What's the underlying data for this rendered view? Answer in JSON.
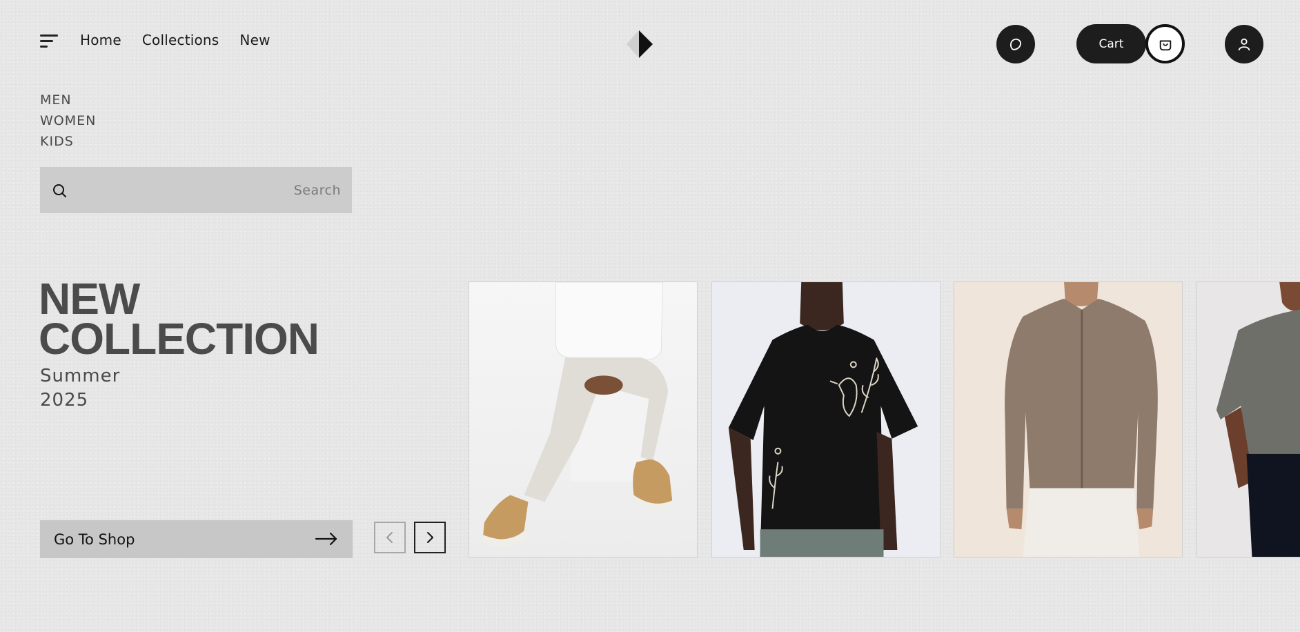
{
  "nav": {
    "links": [
      {
        "label": "Home"
      },
      {
        "label": "Collections"
      },
      {
        "label": "New"
      }
    ],
    "cart_label": "Cart",
    "icons": [
      "menu-icon",
      "brand-logo",
      "heart-icon",
      "bag-icon",
      "user-icon"
    ]
  },
  "categories": [
    {
      "label": "MEN"
    },
    {
      "label": "WOMEN"
    },
    {
      "label": "KIDS"
    }
  ],
  "search": {
    "placeholder": "Search",
    "value": ""
  },
  "hero": {
    "title_line1": "NEW",
    "title_line2": "COLLECTION",
    "subtitle_line1": "Summer",
    "subtitle_line2": "2025",
    "cta_label": "Go To Shop"
  },
  "carousel": {
    "products": [
      {
        "image": "man in white sweatshirt and cream trousers with tan high-top sneakers"
      },
      {
        "image": "man in black t-shirt with embroidered bird and floral motif"
      },
      {
        "image": "man in brown ribbed zip-up knit cardigan"
      },
      {
        "image": "man in washed grey t-shirt (partially visible)"
      }
    ],
    "prev_enabled": false,
    "next_enabled": true
  },
  "colors": {
    "background": "#e7e7e7",
    "accent_dark": "#1d1d1d",
    "panel_grey": "#cccccc",
    "heading_grey": "#4b4b4b"
  }
}
